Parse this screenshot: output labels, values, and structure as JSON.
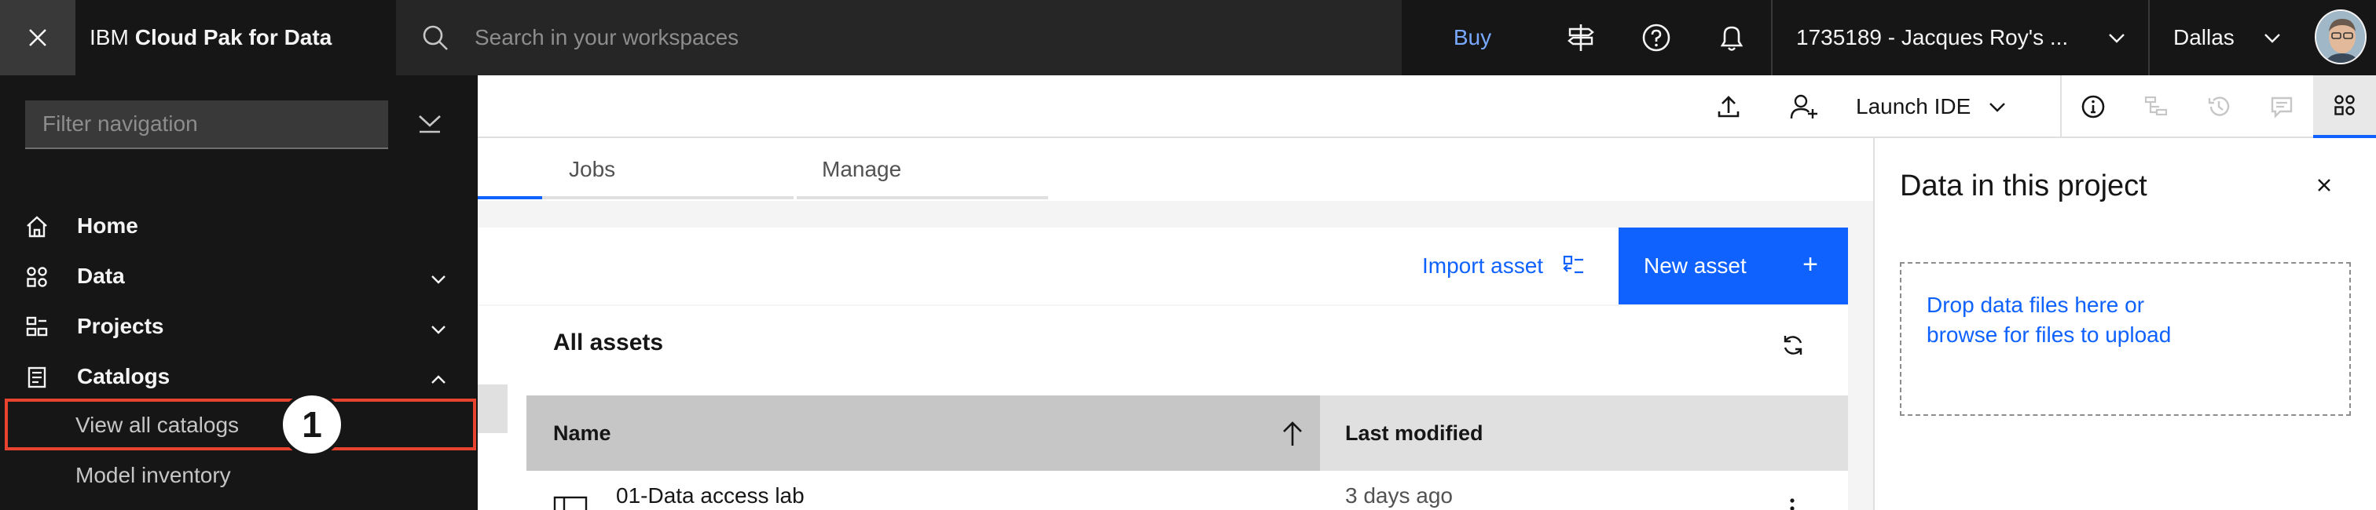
{
  "header": {
    "brand_prefix": "IBM",
    "brand_name": "Cloud Pak for Data",
    "search_placeholder": "Search in your workspaces",
    "buy_label": "Buy",
    "account_label": "1735189 - Jacques Roy's ...",
    "region_label": "Dallas"
  },
  "toolbar": {
    "launch_ide_label": "Launch IDE"
  },
  "tabs": [
    {
      "label": "Jobs"
    },
    {
      "label": "Manage"
    }
  ],
  "assets": {
    "import_label": "Import asset",
    "new_label": "New asset",
    "new_icon": "+",
    "title": "All assets",
    "columns": {
      "name": "Name",
      "modified": "Last modified"
    },
    "rows": [
      {
        "name": "01-Data access lab",
        "modified": "3 days ago"
      }
    ]
  },
  "side_panel": {
    "title": "Data in this project",
    "drop_line1": "Drop data files here or",
    "drop_line2": "browse for files to upload"
  },
  "nav": {
    "filter_placeholder": "Filter navigation",
    "items": [
      {
        "label": "Home",
        "icon": "home-icon"
      },
      {
        "label": "Data",
        "icon": "data-icon"
      },
      {
        "label": "Projects",
        "icon": "projects-icon"
      },
      {
        "label": "Catalogs",
        "icon": "catalogs-icon"
      }
    ],
    "catalog_sub": [
      {
        "label": "View all catalogs"
      },
      {
        "label": "Model inventory"
      }
    ]
  },
  "annotation": {
    "callout_number": "1",
    "highlight_color": "#e8432f"
  },
  "colors": {
    "header_bg": "#161616",
    "accent": "#0f62fe",
    "link": "#78a9ff"
  }
}
